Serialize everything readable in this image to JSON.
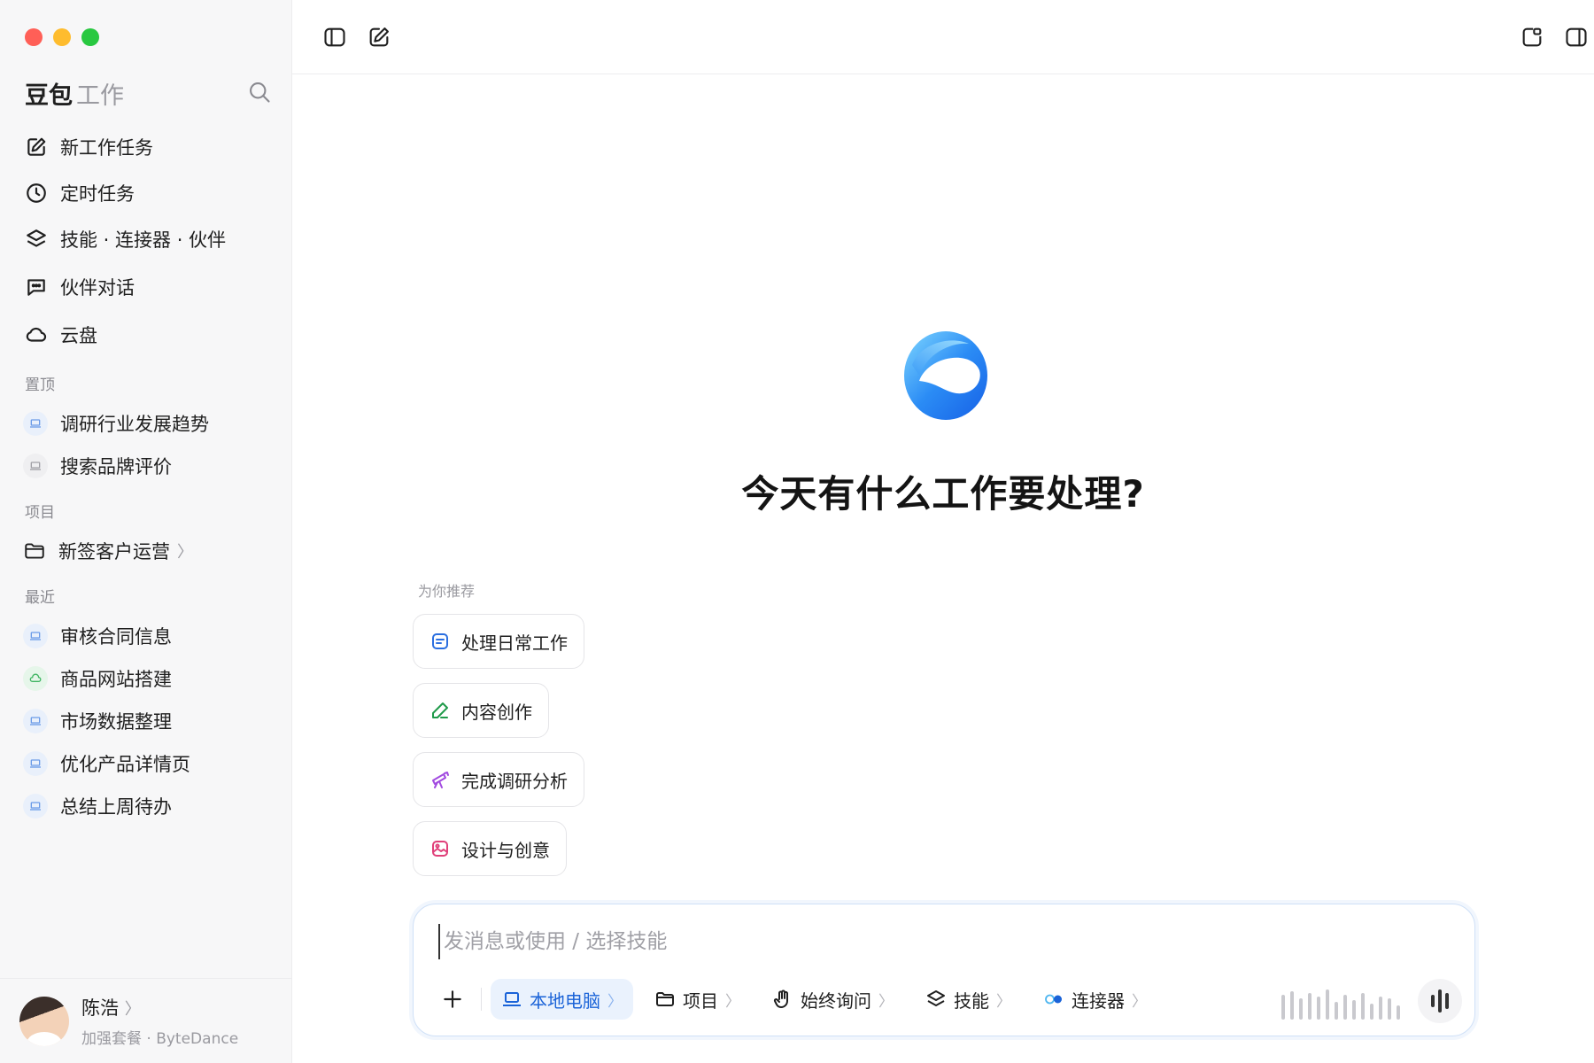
{
  "sidebar": {
    "brand_main": "豆包",
    "brand_sub": "工作",
    "nav": [
      {
        "label": "新工作任务",
        "icon": "edit-icon"
      },
      {
        "label": "定时任务",
        "icon": "clock-icon"
      },
      {
        "label": "技能 · 连接器 · 伙伴",
        "icon": "layers-icon"
      },
      {
        "label": "伙伴对话",
        "icon": "chat-icon"
      },
      {
        "label": "云盘",
        "icon": "cloud-icon"
      }
    ],
    "pinned_label": "置顶",
    "pinned": [
      {
        "label": "调研行业发展趋势"
      },
      {
        "label": "搜索品牌评价"
      }
    ],
    "projects_label": "项目",
    "projects": [
      {
        "label": "新签客户运营",
        "chevron": "〉"
      }
    ],
    "recent_label": "最近",
    "recent": [
      {
        "label": "审核合同信息"
      },
      {
        "label": "商品网站搭建"
      },
      {
        "label": "市场数据整理"
      },
      {
        "label": "优化产品详情页"
      },
      {
        "label": "总结上周待办"
      }
    ],
    "profile": {
      "name": "陈浩",
      "chevron": "〉",
      "plan": "加强套餐 · ByteDance"
    }
  },
  "main": {
    "headline": "今天有什么工作要处理?",
    "rec_label": "为你推荐",
    "recommendations": [
      {
        "label": "处理日常工作",
        "color": "#2b6fe0"
      },
      {
        "label": "内容创作",
        "color": "#1f9a4a"
      },
      {
        "label": "完成调研分析",
        "color": "#a24be0"
      },
      {
        "label": "设计与创意",
        "color": "#e0407a"
      }
    ],
    "composer": {
      "placeholder": "发消息或使用 / 选择技能",
      "pills": [
        {
          "label": "本地电脑",
          "chevron": "〉"
        },
        {
          "label": "项目",
          "chevron": "〉"
        },
        {
          "label": "始终询问",
          "chevron": "〉"
        },
        {
          "label": "技能",
          "chevron": "〉"
        },
        {
          "label": "连接器",
          "chevron": "〉"
        }
      ]
    }
  },
  "colors": {
    "accent": "#1a63d8",
    "traffic_red": "#ff5f57",
    "traffic_yellow": "#febc2e",
    "traffic_green": "#28c840"
  }
}
